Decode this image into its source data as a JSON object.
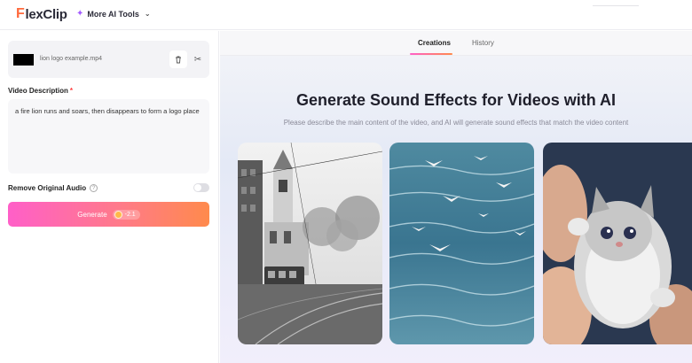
{
  "header": {
    "logo_prefix": "F",
    "logo_text": "lexClip",
    "tools_label": "More AI Tools"
  },
  "upload": {
    "file_name": "lion logo example.mp4"
  },
  "description": {
    "label": "Video Description",
    "required_mark": "*",
    "value": "a fire lion runs and soars, then disappears to form a logo place"
  },
  "audio": {
    "label": "Remove Original Audio",
    "help_glyph": "?",
    "enabled": false
  },
  "generate": {
    "label": "Generate",
    "credits": "-2.1"
  },
  "tabs": [
    {
      "label": "Creations",
      "active": true
    },
    {
      "label": "History",
      "active": false
    }
  ],
  "hero": {
    "title": "Generate Sound Effects for Videos with AI",
    "subtitle": "Please describe the main content of the video, and AI will generate sound effects that match the video content"
  },
  "examples": [
    {
      "subject": "city-tram-street-bw"
    },
    {
      "subject": "seagulls-over-ocean"
    },
    {
      "subject": "kitten-in-hands"
    }
  ],
  "colors": {
    "accent_start": "#ff5fc8",
    "accent_end": "#ff8a4c",
    "logo_accent": "#ff6a3d"
  }
}
